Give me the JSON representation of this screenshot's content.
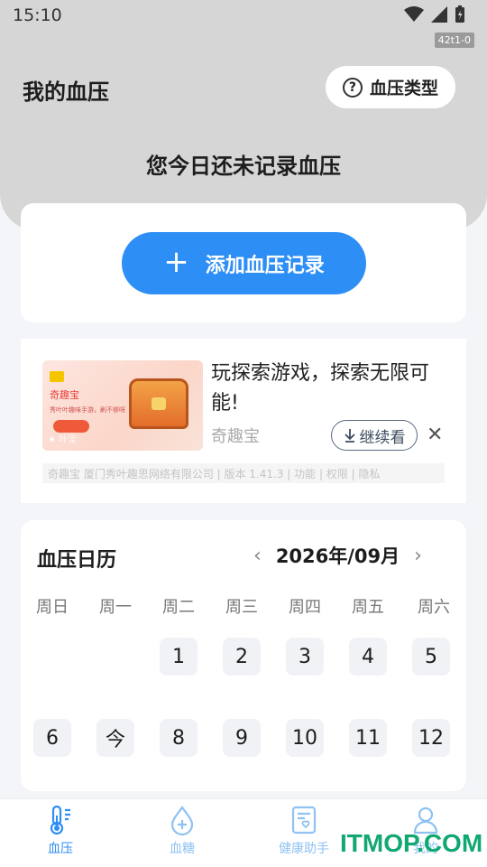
{
  "status_bar": {
    "time": "15:10",
    "build": "42t1-0"
  },
  "header": {
    "title": "我的血压",
    "bp_type_button": "血压类型",
    "help_glyph": "?",
    "today_message": "您今日还未记录血压"
  },
  "add_record": {
    "plus": "+",
    "label": "添加血压记录"
  },
  "ad": {
    "brand_image_text": "奇趣宝",
    "image_tagline": "秀叶叶趣味手游，刷不够呀",
    "image_watermark": "♦ 叶宝",
    "headline": "玩探索游戏，探索无限可能!",
    "advertiser": "奇趣宝",
    "continue_label": "继续看",
    "close_glyph": "✕",
    "footer": "奇趣宝 厦门秀叶趣思网络有限公司 | 版本 1.41.3 | 功能 | 权限 | 隐私"
  },
  "calendar": {
    "title": "血压日历",
    "month": "2026年/09月",
    "prev": "‹",
    "next": "›",
    "weekdays": [
      "周日",
      "周一",
      "周二",
      "周三",
      "周四",
      "周五",
      "周六"
    ],
    "week1": [
      "1",
      "2",
      "3",
      "4",
      "5"
    ],
    "week2": [
      "6",
      "今",
      "8",
      "9",
      "10",
      "11",
      "12"
    ]
  },
  "bottom_nav": [
    {
      "label": "血压",
      "icon": "thermometer-icon",
      "active": true
    },
    {
      "label": "血糖",
      "icon": "blood-drop-icon",
      "active": false
    },
    {
      "label": "健康助手",
      "icon": "health-doc-icon",
      "active": false
    },
    {
      "label": "我的",
      "icon": "user-icon",
      "active": false
    }
  ],
  "watermark": "ITMOP.COM",
  "colors": {
    "accent": "#2d8ef5",
    "header_bg": "#d6d6d6",
    "nav_inactive": "#8ec2f2",
    "watermark": "#12a872"
  }
}
